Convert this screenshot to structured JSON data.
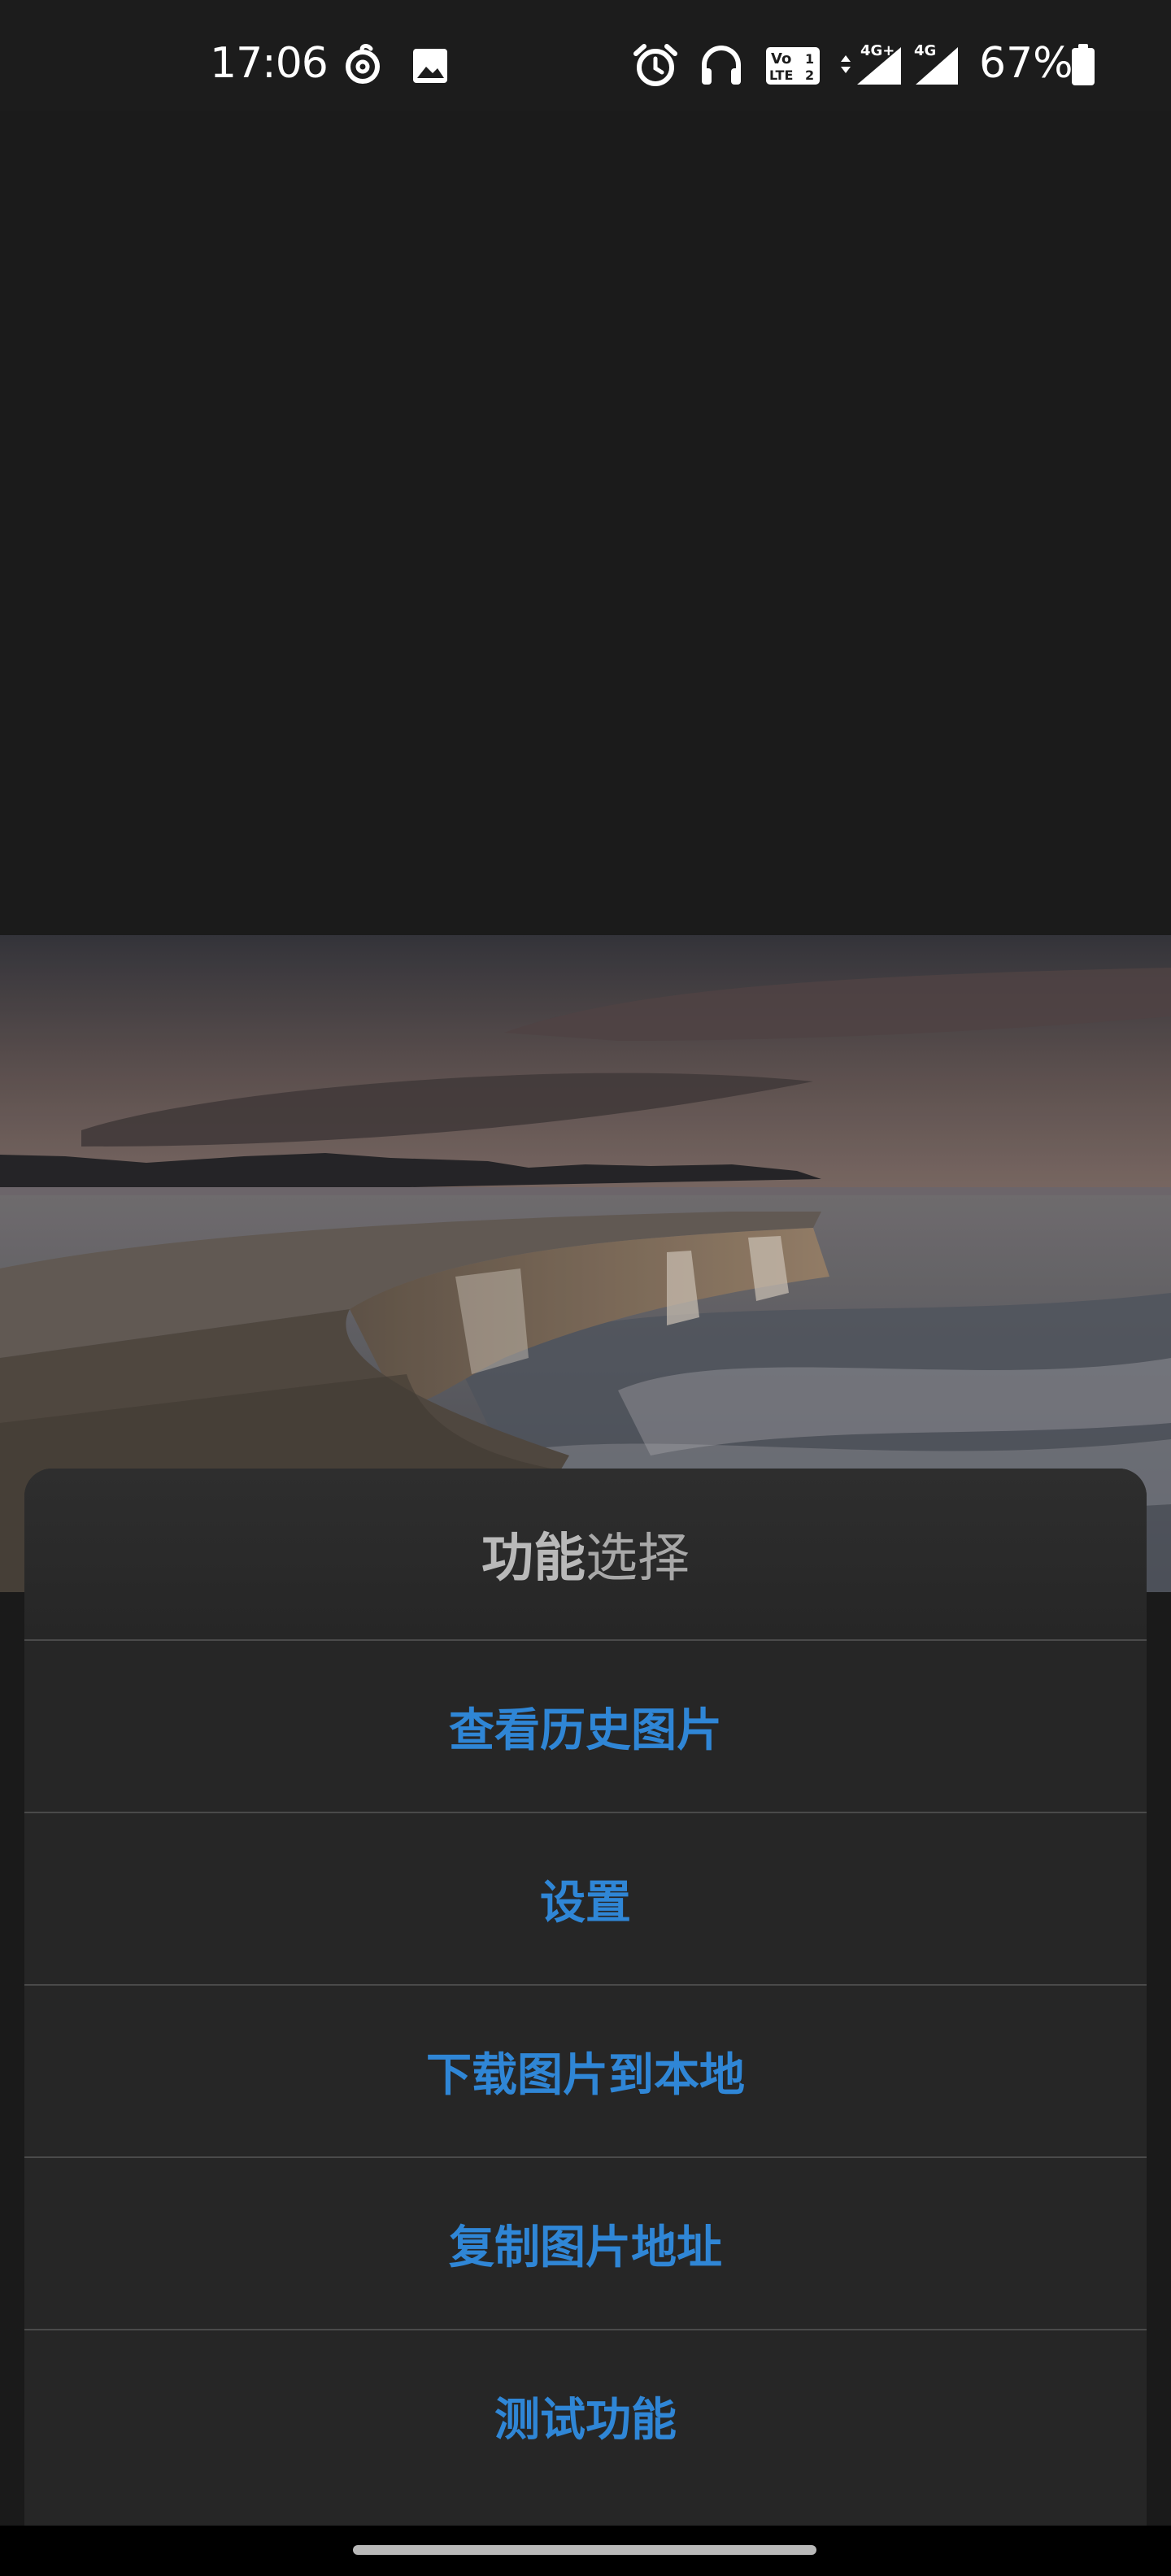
{
  "status_bar": {
    "time": "17:06",
    "battery_percent": "67%",
    "left_icons": [
      "netease-music-icon",
      "image-notification-icon"
    ],
    "right_icons": [
      "alarm-icon",
      "headphones-icon",
      "volte-icon",
      "signal-4g-plus-icon",
      "signal-4g-icon",
      "battery-icon"
    ],
    "signal_labels": {
      "sim1": "4G+",
      "sim2": "4G"
    },
    "volte_label": {
      "top": "Vo",
      "bottom": "LTE"
    }
  },
  "sheet": {
    "title_bold": "功能",
    "title_rest": "选择",
    "items": [
      {
        "label": "查看历史图片"
      },
      {
        "label": "设置"
      },
      {
        "label": "下载图片到本地"
      },
      {
        "label": "复制图片地址"
      },
      {
        "label": "测试功能"
      }
    ]
  },
  "colors": {
    "accent": "#2f86d6",
    "sheet_bg": "#262626",
    "page_bg": "#1a1a1a"
  }
}
